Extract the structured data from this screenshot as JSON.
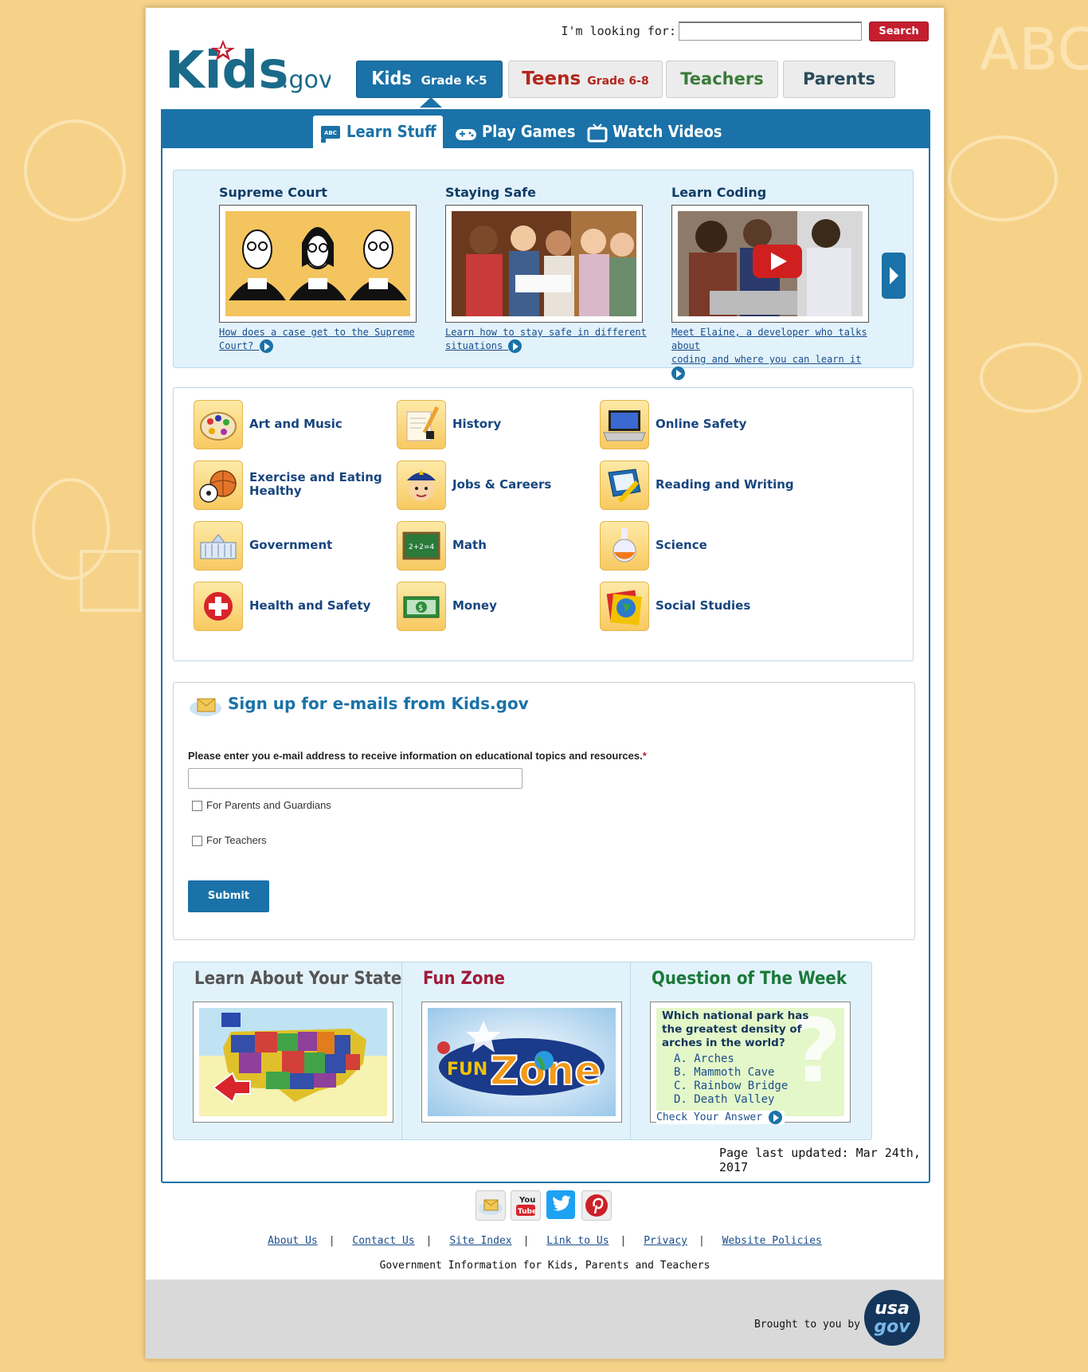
{
  "header": {
    "logo_text_main": "Kids",
    "logo_text_suffix": ".gov",
    "search_label": "I'm looking for:",
    "search_value": "",
    "search_button": "Search",
    "nav": [
      {
        "label": "Kids",
        "sub": "Grade K-5"
      },
      {
        "label": "Teens",
        "sub": "Grade 6-8"
      },
      {
        "label": "Teachers"
      },
      {
        "label": "Parents"
      }
    ]
  },
  "subnav": {
    "tabs": [
      {
        "label": "Learn Stuff",
        "icon": "abc-book-icon"
      },
      {
        "label": "Play Games",
        "icon": "game-controller-icon"
      },
      {
        "label": "Watch Videos",
        "icon": "tv-icon"
      }
    ]
  },
  "featured": [
    {
      "title": "Supreme Court",
      "link_line1": "How does a case get to the Supreme",
      "link_line2": "Court?"
    },
    {
      "title": "Staying Safe",
      "link_line1": "Learn how to stay safe in different",
      "link_line2": "situations"
    },
    {
      "title": "Learn Coding",
      "link_line1": "Meet Elaine, a developer who talks about",
      "link_line2": "coding and where you can learn it"
    }
  ],
  "topics": [
    {
      "label": "Art and Music",
      "icon": "palette-icon"
    },
    {
      "label": "History",
      "icon": "scroll-quill-icon"
    },
    {
      "label": "Online Safety",
      "icon": "laptop-icon"
    },
    {
      "label": "Exercise and Eating Healthy",
      "icon": "sports-balls-icon"
    },
    {
      "label": "Jobs & Careers",
      "icon": "police-officer-icon"
    },
    {
      "label": "Reading and Writing",
      "icon": "book-pencil-icon"
    },
    {
      "label": "Government",
      "icon": "white-house-icon"
    },
    {
      "label": "Math",
      "icon": "chalkboard-icon"
    },
    {
      "label": "Science",
      "icon": "beaker-icon"
    },
    {
      "label": "Health and Safety",
      "icon": "red-cross-icon"
    },
    {
      "label": "Money",
      "icon": "dollar-bill-icon"
    },
    {
      "label": "Social Studies",
      "icon": "globe-icon"
    }
  ],
  "signup": {
    "title": "Sign up for e-mails from Kids.gov",
    "prompt": "Please enter you e-mail address to receive information on educational topics and resources.",
    "required_mark": "*",
    "email_value": "",
    "option_parents": "For Parents and Guardians",
    "option_teachers": "For Teachers",
    "submit": "Submit"
  },
  "boxes": {
    "state_title": "Learn About Your State",
    "fun_title": "Fun Zone",
    "fun_logo_word1": "FUN",
    "fun_logo_word2": "Zone",
    "question_title": "Question of The Week",
    "question": "Which national park has the greatest density of arches in the world?",
    "answers": [
      "A.  Arches",
      "B.  Mammoth Cave",
      "C.  Rainbow Bridge",
      "D.  Death Valley"
    ],
    "check_answer": "Check Your Answer"
  },
  "updated": "Page last updated: Mar 24th, 2017",
  "footer": {
    "links": [
      "About Us",
      "Contact Us",
      "Site Index",
      "Link to Us",
      "Privacy",
      "Website Policies"
    ],
    "tagline": "Government Information for Kids, Parents and Teachers",
    "brought_by": "Brought to you by",
    "usagov_line1": "usa",
    "usagov_line2": "gov",
    "youtube_line1": "You",
    "youtube_line2": "Tube"
  },
  "colors": {
    "brand_blue": "#1a72a8",
    "search_red": "#c41e2f",
    "background": "#f6d289"
  }
}
